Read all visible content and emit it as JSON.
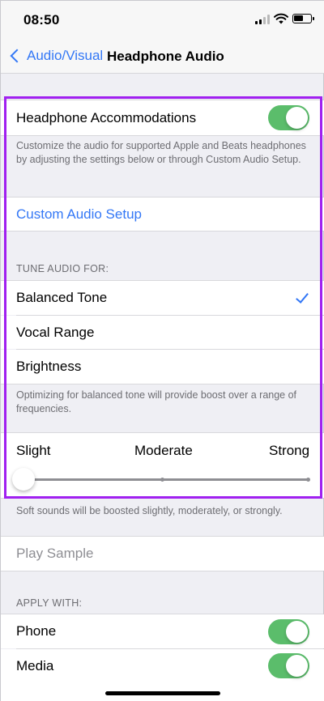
{
  "status_bar": {
    "time": "08:50"
  },
  "nav": {
    "back_label": "Audio/Visual",
    "title": "Headphone Audio"
  },
  "accommodations": {
    "label": "Headphone Accommodations",
    "enabled": true,
    "description": "Customize the audio for supported Apple and Beats headphones by adjusting the settings below or through Custom Audio Setup."
  },
  "custom_setup": {
    "label": "Custom Audio Setup"
  },
  "tune": {
    "header": "TUNE AUDIO FOR:",
    "options": [
      "Balanced Tone",
      "Vocal Range",
      "Brightness"
    ],
    "selected": "Balanced Tone",
    "description": "Optimizing for balanced tone will provide boost over a range of frequencies."
  },
  "boost": {
    "labels": [
      "Slight",
      "Moderate",
      "Strong"
    ],
    "value": "Slight",
    "description": "Soft sounds will be boosted slightly, moderately, or strongly."
  },
  "play_sample": {
    "label": "Play Sample"
  },
  "apply_with": {
    "header": "APPLY WITH:",
    "phone_label": "Phone",
    "phone_enabled": true,
    "media_label": "Media",
    "media_enabled": true
  },
  "colors": {
    "accent": "#3478f6",
    "toggle_on": "#5bbd6b",
    "highlight": "#a020f0"
  }
}
